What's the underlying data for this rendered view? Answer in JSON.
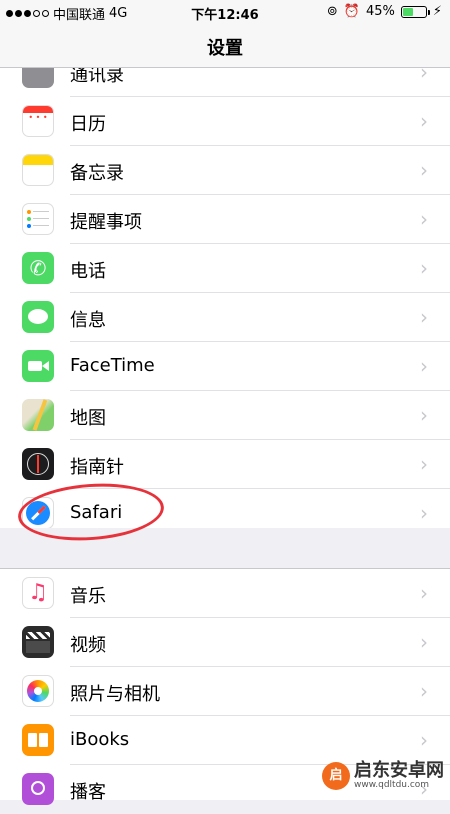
{
  "status_bar": {
    "carrier": "中国联通",
    "network": "4G",
    "time": "下午12:46",
    "battery_percent": "45%",
    "battery_level": 0.45
  },
  "nav": {
    "title": "设置"
  },
  "rows": [
    {
      "label": "通讯录",
      "icon": "contacts-icon",
      "color": "#8e8e93"
    },
    {
      "label": "日历",
      "icon": "calendar-icon",
      "color": "#ffffff"
    },
    {
      "label": "备忘录",
      "icon": "notes-icon",
      "color": "#ffd60a"
    },
    {
      "label": "提醒事项",
      "icon": "reminders-icon",
      "color": "#ffffff"
    },
    {
      "label": "电话",
      "icon": "phone-icon",
      "color": "#4cd964"
    },
    {
      "label": "信息",
      "icon": "messages-icon",
      "color": "#4cd964"
    },
    {
      "label": "FaceTime",
      "icon": "facetime-icon",
      "color": "#4cd964"
    },
    {
      "label": "地图",
      "icon": "maps-icon",
      "color": "#7fd06b"
    },
    {
      "label": "指南针",
      "icon": "compass-icon",
      "color": "#1c1c1e"
    },
    {
      "label": "Safari",
      "icon": "safari-icon",
      "color": "#1a8cff"
    },
    {
      "label": "音乐",
      "icon": "music-icon",
      "color": "#ffffff"
    },
    {
      "label": "视频",
      "icon": "videos-icon",
      "color": "#2b2b2b"
    },
    {
      "label": "照片与相机",
      "icon": "photos-icon",
      "color": "#ffffff"
    },
    {
      "label": "iBooks",
      "icon": "ibooks-icon",
      "color": "#ff9500"
    },
    {
      "label": "播客",
      "icon": "podcasts-icon",
      "color": "#b14fd8"
    }
  ],
  "chevron": "›",
  "watermark": {
    "name": "启东安卓网",
    "url": "www.qdltdu.com"
  }
}
